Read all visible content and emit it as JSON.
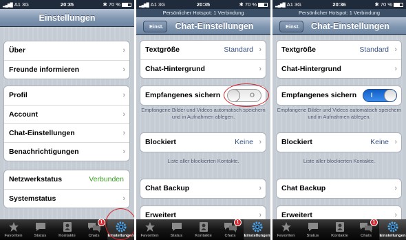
{
  "statusbar": {
    "carrier": "A1",
    "network": "3G",
    "battery": "70 %",
    "bluetooth_icon": "bluetooth-icon"
  },
  "screens": [
    {
      "time": "20:35",
      "hotspot": "",
      "nav_title": "Einstellungen",
      "back_label": "",
      "groups": [
        {
          "rows": [
            "Über",
            "Freunde informieren"
          ]
        },
        {
          "rows": [
            "Profil",
            "Account",
            "Chat-Einstellungen",
            "Benachrichtigungen"
          ]
        },
        {
          "rows": [
            {
              "label": "Netzwerkstatus",
              "value": "Verbunden",
              "value_color": "#3a9d23"
            },
            {
              "label": "Systemstatus"
            }
          ]
        }
      ]
    },
    {
      "time": "20:35",
      "hotspot": "Persönlicher Hotspot: 1 Verbindung",
      "nav_title": "Chat-Einstellungen",
      "back_label": "Einst.",
      "textsize_label": "Textgröße",
      "textsize_value": "Standard",
      "background_label": "Chat-Hintergrund",
      "save_label": "Empfangenes sichern",
      "save_toggle": "off",
      "save_note": "Empfangene Bilder und Videos automatisch speichern und in Aufnahmen ablegen.",
      "blocked_label": "Blockiert",
      "blocked_value": "Keine",
      "blocked_note": "Liste aller blockierten Kontakte.",
      "backup_label": "Chat Backup",
      "advanced_label": "Erweitert"
    },
    {
      "time": "20:36",
      "hotspot": "Persönlicher Hotspot: 1 Verbindung",
      "nav_title": "Chat-Einstellungen",
      "back_label": "Einst.",
      "textsize_label": "Textgröße",
      "textsize_value": "Standard",
      "background_label": "Chat-Hintergrund",
      "save_label": "Empfangenes sichern",
      "save_toggle": "on",
      "save_note": "Empfangene Bilder und Videos automatisch speichern und in Aufnahmen ablegen.",
      "blocked_label": "Blockiert",
      "blocked_value": "Keine",
      "blocked_note": "Liste aller blockierten Kontakte.",
      "backup_label": "Chat Backup",
      "advanced_label": "Erweitert"
    }
  ],
  "toggle": {
    "off_glyph": "O",
    "on_glyph": "I"
  },
  "tabs": {
    "favorites": "Favoriten",
    "status": "Status",
    "contacts": "Kontakte",
    "chats": "Chats",
    "chats_badge": "1",
    "settings": "Einstellungen"
  },
  "colors": {
    "accent_value": "#385487",
    "connected_green": "#3a9d23",
    "badge_red": "#d8232a",
    "toggle_on_blue": "#1f72dd"
  }
}
